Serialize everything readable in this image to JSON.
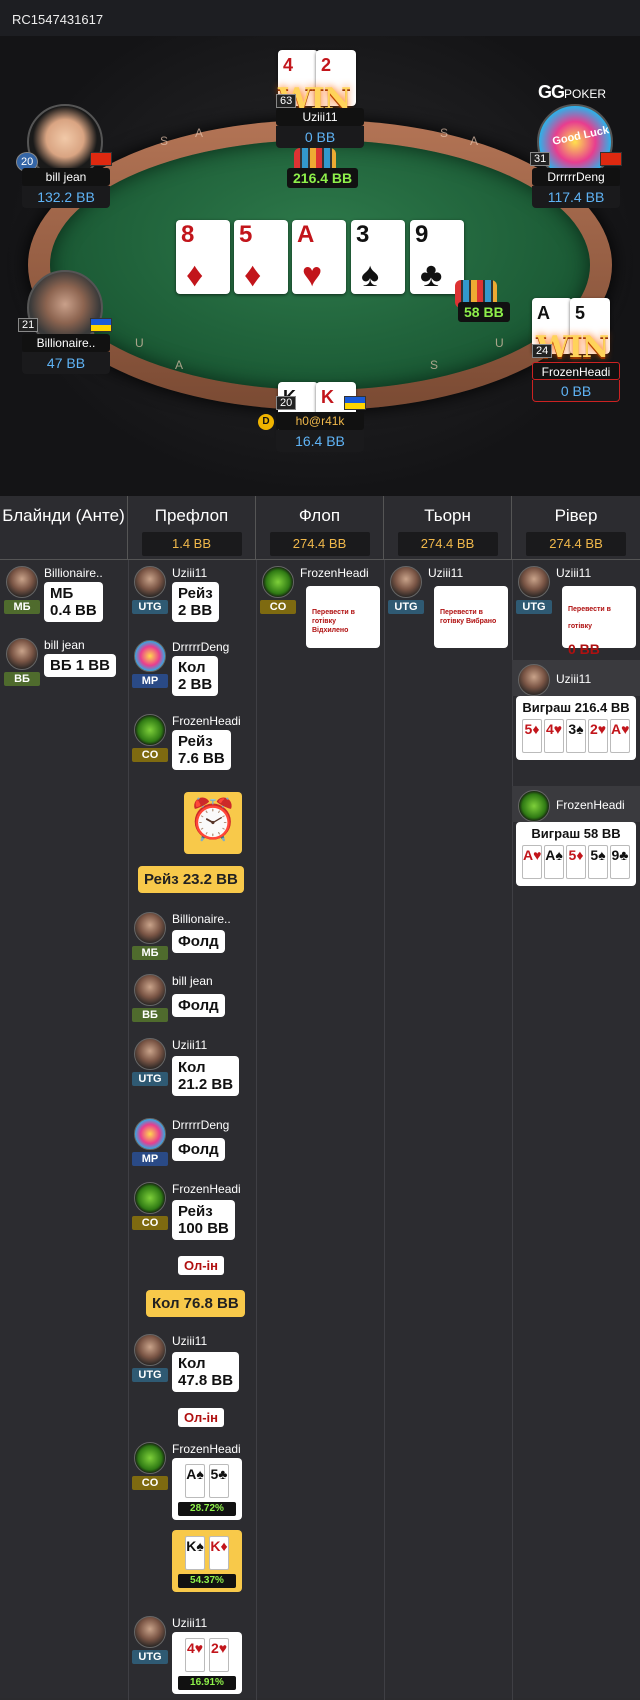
{
  "hand_id": "RC1547431617",
  "logo": {
    "gg": "GG",
    "poker": "POKER"
  },
  "rim_letters": [
    "S",
    "A",
    "S",
    "A",
    "S",
    "U",
    "A",
    "S",
    "U",
    "S"
  ],
  "board": [
    {
      "rank": "8",
      "suit": "♦",
      "color": "red"
    },
    {
      "rank": "5",
      "suit": "♦",
      "color": "red"
    },
    {
      "rank": "A",
      "suit": "♥",
      "color": "red"
    },
    {
      "rank": "3",
      "suit": "♠",
      "color": "black"
    },
    {
      "rank": "9",
      "suit": "♣",
      "color": "black"
    }
  ],
  "pots": {
    "main": "216.4 BB",
    "side": "58 BB"
  },
  "seats": [
    {
      "id": "uziii",
      "name": "Uziii11",
      "stack": "0 BB",
      "level": "63",
      "win": "WIN",
      "cards": [
        {
          "rank": "4",
          "suit": "♥",
          "color": "red"
        },
        {
          "rank": "2",
          "suit": "♥",
          "color": "red"
        }
      ]
    },
    {
      "id": "bill",
      "name": "bill jean",
      "stack": "132.2 BB",
      "level": "20"
    },
    {
      "id": "deng",
      "name": "DrrrrrDeng",
      "stack": "117.4 BB",
      "level": "31",
      "avatar_text": "Good Luck"
    },
    {
      "id": "bill2",
      "name": "Billionaire..",
      "stack": "47 BB",
      "level": "21"
    },
    {
      "id": "frozen",
      "name": "FrozenHeadi",
      "stack": "0 BB",
      "level": "24",
      "win": "WIN",
      "cards": [
        {
          "rank": "A",
          "suit": "♠",
          "color": "black"
        },
        {
          "rank": "5",
          "suit": "♠",
          "color": "black"
        }
      ]
    },
    {
      "id": "hero",
      "name": "h0@r41k",
      "stack": "16.4 BB",
      "level": "20",
      "dealer": "D",
      "cards": [
        {
          "rank": "K",
          "suit": "♠",
          "color": "black"
        },
        {
          "rank": "K",
          "suit": "♦",
          "color": "red"
        }
      ]
    }
  ],
  "columns": [
    {
      "title": "Блайнди (Анте)",
      "pot": ""
    },
    {
      "title": "Префлоп",
      "pot": "1.4 BB"
    },
    {
      "title": "Флоп",
      "pot": "274.4 BB"
    },
    {
      "title": "Тьорн",
      "pot": "274.4 BB"
    },
    {
      "title": "Рівер",
      "pot": "274.4 BB"
    }
  ],
  "blinds": [
    {
      "name": "Billionaire..",
      "pos": "МБ",
      "action": "МБ\n0.4 BB"
    },
    {
      "name": "bill jean",
      "pos": "ВБ",
      "action": "ВБ 1 BB"
    }
  ],
  "preflop": {
    "a1": {
      "name": "Uziii11",
      "pos": "UTG",
      "action": "Рейз\n2 BB"
    },
    "a2": {
      "name": "DrrrrrDeng",
      "pos": "MP",
      "action": "Кол\n2 BB"
    },
    "a3": {
      "name": "FrozenHeadi",
      "pos": "CO",
      "action": "Рейз\n7.6 BB"
    },
    "hero_raise": "Рейз 23.2 BB",
    "a4": {
      "name": "Billionaire..",
      "pos": "МБ",
      "action": "Фолд"
    },
    "a5": {
      "name": "bill jean",
      "pos": "ВБ",
      "action": "Фолд"
    },
    "a6": {
      "name": "Uziii11",
      "pos": "UTG",
      "action": "Кол\n21.2 BB"
    },
    "a7": {
      "name": "DrrrrrDeng",
      "pos": "MP",
      "action": "Фолд"
    },
    "a8": {
      "name": "FrozenHeadi",
      "pos": "CO",
      "action": "Рейз\n100 BB",
      "tag": "Ол-ін"
    },
    "hero_call": "Кол 76.8 BB",
    "a9": {
      "name": "Uziii11",
      "pos": "UTG",
      "action": "Кол\n47.8 BB",
      "tag": "Ол-ін"
    },
    "eq1": {
      "name": "FrozenHeadi",
      "pos": "CO",
      "cards": [
        "A♠",
        "5♣"
      ],
      "equity": "28.72%"
    },
    "eq_hero": {
      "cards": [
        "K♠",
        "K♦"
      ],
      "equity": "54.37%"
    },
    "eq2": {
      "name": "Uziii11",
      "pos": "UTG",
      "cards": [
        "4♥",
        "2♥"
      ],
      "equity": "16.91%"
    }
  },
  "flop": {
    "name": "FrozenHeadi",
    "pos": "CO",
    "note": "Перевести в готівку Відхилено"
  },
  "turn": {
    "name": "Uziii11",
    "pos": "UTG",
    "note": "Перевести в готівку Вибрано"
  },
  "river": {
    "name": "Uziii11",
    "pos": "UTG",
    "note": "Перевести в готівку",
    "amount": "0 BB",
    "win1": {
      "name": "Uziii11",
      "label": "Виграш 216.4 BB",
      "cards": [
        "5♦",
        "4♥",
        "3♠",
        "2♥",
        "A♥"
      ]
    },
    "win2": {
      "name": "FrozenHeadi",
      "label": "Виграш 58 BB",
      "cards": [
        "A♥",
        "A♠",
        "5♦",
        "5♠",
        "9♣"
      ]
    }
  }
}
